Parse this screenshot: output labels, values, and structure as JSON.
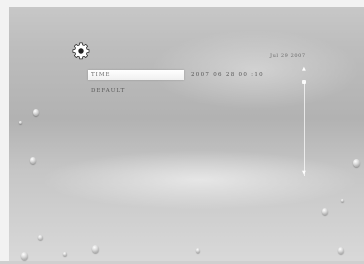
{
  "menu": {
    "items": [
      {
        "label": "TIME",
        "value": "2007  06 28  00 :10",
        "selected": true
      },
      {
        "label": "DEFAULT"
      }
    ]
  },
  "header": {
    "date": "Jul 29 2007"
  },
  "icons": {
    "settings": "gear-icon"
  },
  "colors": {
    "background": "#bdbdbd",
    "selection": "#ffffff",
    "text": "#555555"
  }
}
